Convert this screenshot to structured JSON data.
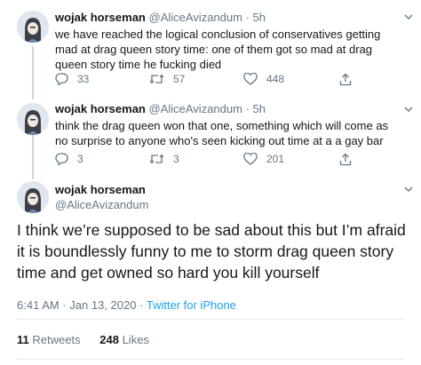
{
  "tweets": [
    {
      "name": "wojak horseman",
      "handle": "@AliceAvizandum",
      "dot": "·",
      "time": "5h",
      "text": "we have reached the logical conclusion of conservatives getting mad at drag queen story time: one of them got so mad at drag queen story time he fucking died",
      "replies": "33",
      "retweets": "57",
      "likes": "448"
    },
    {
      "name": "wojak horseman",
      "handle": "@AliceAvizandum",
      "dot": "·",
      "time": "5h",
      "text": "think the drag queen won that one, something which will come as no surprise to anyone who's seen kicking out time at a a gay bar",
      "replies": "3",
      "retweets": "3",
      "likes": "201"
    }
  ],
  "main": {
    "name": "wojak horseman",
    "handle": "@AliceAvizandum",
    "text": "I think we’re supposed to be sad about this but I’m afraid it is boundlessly funny to me to storm drag queen story time and get owned so hard you kill yourself",
    "timestamp": "6:41 AM · Jan 13, 2020 · ",
    "client": "Twitter for iPhone",
    "retweets_count": "11",
    "retweets_label": "Retweets",
    "likes_count": "248",
    "likes_label": "Likes"
  },
  "icons": {
    "reply": "reply-icon",
    "retweet": "retweet-icon",
    "like": "heart-icon",
    "share": "share-icon",
    "caret": "chevron-down-icon"
  },
  "colors": {
    "text": "#14171a",
    "secondary": "#657786",
    "link": "#1da1f2",
    "divider": "#e6ecf0"
  }
}
